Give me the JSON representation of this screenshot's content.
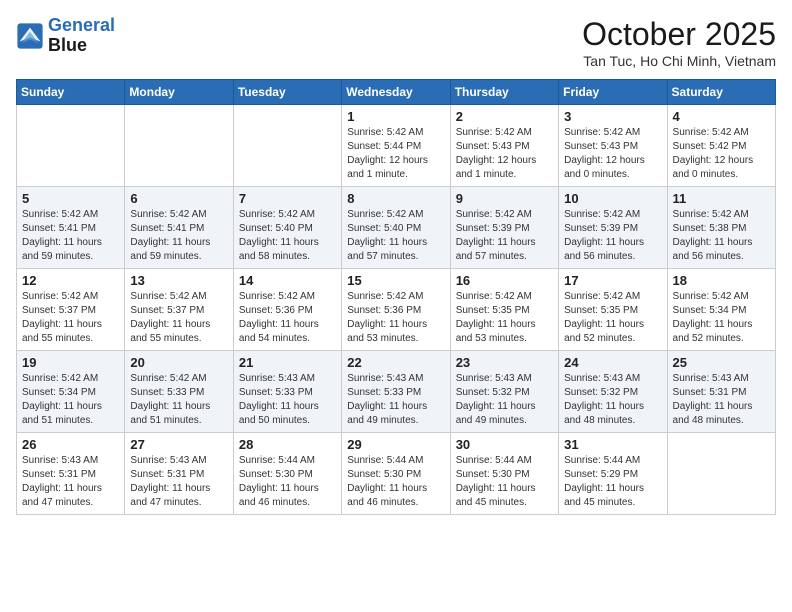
{
  "header": {
    "logo_line1": "General",
    "logo_line2": "Blue",
    "month_year": "October 2025",
    "location": "Tan Tuc, Ho Chi Minh, Vietnam"
  },
  "days_of_week": [
    "Sunday",
    "Monday",
    "Tuesday",
    "Wednesday",
    "Thursday",
    "Friday",
    "Saturday"
  ],
  "weeks": [
    [
      {
        "day": "",
        "info": ""
      },
      {
        "day": "",
        "info": ""
      },
      {
        "day": "",
        "info": ""
      },
      {
        "day": "1",
        "info": "Sunrise: 5:42 AM\nSunset: 5:44 PM\nDaylight: 12 hours\nand 1 minute."
      },
      {
        "day": "2",
        "info": "Sunrise: 5:42 AM\nSunset: 5:43 PM\nDaylight: 12 hours\nand 1 minute."
      },
      {
        "day": "3",
        "info": "Sunrise: 5:42 AM\nSunset: 5:43 PM\nDaylight: 12 hours\nand 0 minutes."
      },
      {
        "day": "4",
        "info": "Sunrise: 5:42 AM\nSunset: 5:42 PM\nDaylight: 12 hours\nand 0 minutes."
      }
    ],
    [
      {
        "day": "5",
        "info": "Sunrise: 5:42 AM\nSunset: 5:41 PM\nDaylight: 11 hours\nand 59 minutes."
      },
      {
        "day": "6",
        "info": "Sunrise: 5:42 AM\nSunset: 5:41 PM\nDaylight: 11 hours\nand 59 minutes."
      },
      {
        "day": "7",
        "info": "Sunrise: 5:42 AM\nSunset: 5:40 PM\nDaylight: 11 hours\nand 58 minutes."
      },
      {
        "day": "8",
        "info": "Sunrise: 5:42 AM\nSunset: 5:40 PM\nDaylight: 11 hours\nand 57 minutes."
      },
      {
        "day": "9",
        "info": "Sunrise: 5:42 AM\nSunset: 5:39 PM\nDaylight: 11 hours\nand 57 minutes."
      },
      {
        "day": "10",
        "info": "Sunrise: 5:42 AM\nSunset: 5:39 PM\nDaylight: 11 hours\nand 56 minutes."
      },
      {
        "day": "11",
        "info": "Sunrise: 5:42 AM\nSunset: 5:38 PM\nDaylight: 11 hours\nand 56 minutes."
      }
    ],
    [
      {
        "day": "12",
        "info": "Sunrise: 5:42 AM\nSunset: 5:37 PM\nDaylight: 11 hours\nand 55 minutes."
      },
      {
        "day": "13",
        "info": "Sunrise: 5:42 AM\nSunset: 5:37 PM\nDaylight: 11 hours\nand 55 minutes."
      },
      {
        "day": "14",
        "info": "Sunrise: 5:42 AM\nSunset: 5:36 PM\nDaylight: 11 hours\nand 54 minutes."
      },
      {
        "day": "15",
        "info": "Sunrise: 5:42 AM\nSunset: 5:36 PM\nDaylight: 11 hours\nand 53 minutes."
      },
      {
        "day": "16",
        "info": "Sunrise: 5:42 AM\nSunset: 5:35 PM\nDaylight: 11 hours\nand 53 minutes."
      },
      {
        "day": "17",
        "info": "Sunrise: 5:42 AM\nSunset: 5:35 PM\nDaylight: 11 hours\nand 52 minutes."
      },
      {
        "day": "18",
        "info": "Sunrise: 5:42 AM\nSunset: 5:34 PM\nDaylight: 11 hours\nand 52 minutes."
      }
    ],
    [
      {
        "day": "19",
        "info": "Sunrise: 5:42 AM\nSunset: 5:34 PM\nDaylight: 11 hours\nand 51 minutes."
      },
      {
        "day": "20",
        "info": "Sunrise: 5:42 AM\nSunset: 5:33 PM\nDaylight: 11 hours\nand 51 minutes."
      },
      {
        "day": "21",
        "info": "Sunrise: 5:43 AM\nSunset: 5:33 PM\nDaylight: 11 hours\nand 50 minutes."
      },
      {
        "day": "22",
        "info": "Sunrise: 5:43 AM\nSunset: 5:33 PM\nDaylight: 11 hours\nand 49 minutes."
      },
      {
        "day": "23",
        "info": "Sunrise: 5:43 AM\nSunset: 5:32 PM\nDaylight: 11 hours\nand 49 minutes."
      },
      {
        "day": "24",
        "info": "Sunrise: 5:43 AM\nSunset: 5:32 PM\nDaylight: 11 hours\nand 48 minutes."
      },
      {
        "day": "25",
        "info": "Sunrise: 5:43 AM\nSunset: 5:31 PM\nDaylight: 11 hours\nand 48 minutes."
      }
    ],
    [
      {
        "day": "26",
        "info": "Sunrise: 5:43 AM\nSunset: 5:31 PM\nDaylight: 11 hours\nand 47 minutes."
      },
      {
        "day": "27",
        "info": "Sunrise: 5:43 AM\nSunset: 5:31 PM\nDaylight: 11 hours\nand 47 minutes."
      },
      {
        "day": "28",
        "info": "Sunrise: 5:44 AM\nSunset: 5:30 PM\nDaylight: 11 hours\nand 46 minutes."
      },
      {
        "day": "29",
        "info": "Sunrise: 5:44 AM\nSunset: 5:30 PM\nDaylight: 11 hours\nand 46 minutes."
      },
      {
        "day": "30",
        "info": "Sunrise: 5:44 AM\nSunset: 5:30 PM\nDaylight: 11 hours\nand 45 minutes."
      },
      {
        "day": "31",
        "info": "Sunrise: 5:44 AM\nSunset: 5:29 PM\nDaylight: 11 hours\nand 45 minutes."
      },
      {
        "day": "",
        "info": ""
      }
    ]
  ]
}
